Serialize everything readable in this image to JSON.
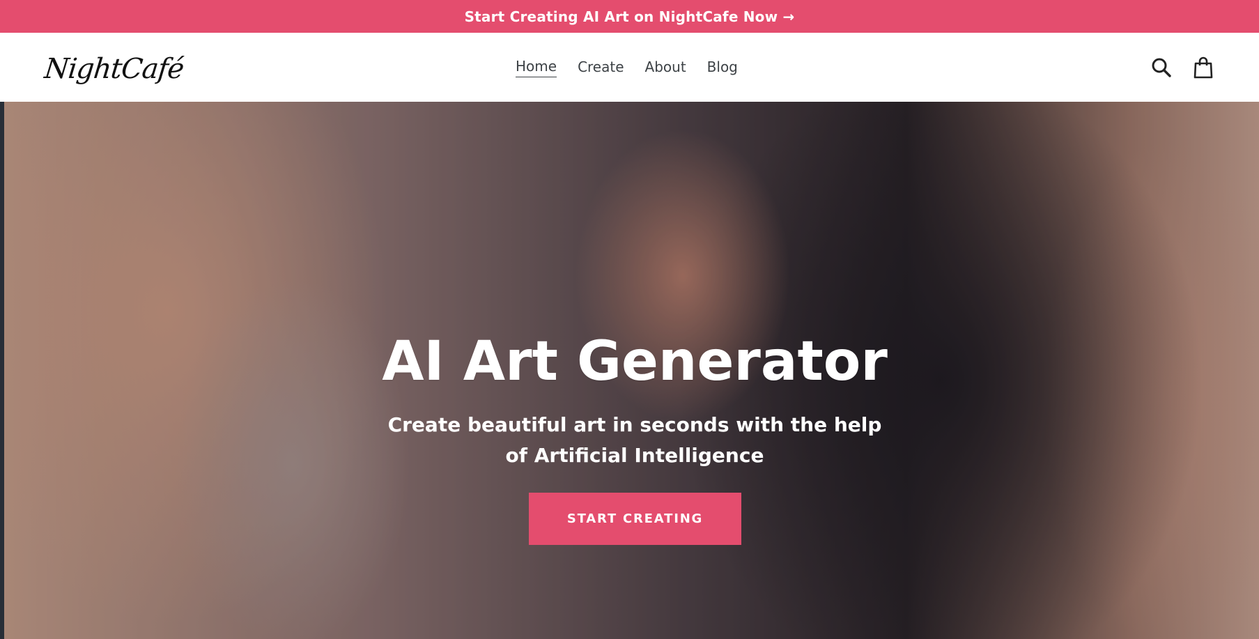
{
  "announcement": {
    "text": "Start Creating AI Art on NightCafe Now →",
    "color": "#e44d6e"
  },
  "header": {
    "logo_text": "NightCafé",
    "nav": [
      {
        "label": "Home",
        "active": true
      },
      {
        "label": "Create",
        "active": false
      },
      {
        "label": "About",
        "active": false
      },
      {
        "label": "Blog",
        "active": false
      }
    ],
    "search_icon": "search-icon",
    "cart_icon": "shopping-bag-icon"
  },
  "hero": {
    "title": "AI Art Generator",
    "subtitle": "Create beautiful art in seconds with the help of Artificial Intelligence",
    "cta_label": "START CREATING",
    "cta_color": "#e44d6e"
  }
}
